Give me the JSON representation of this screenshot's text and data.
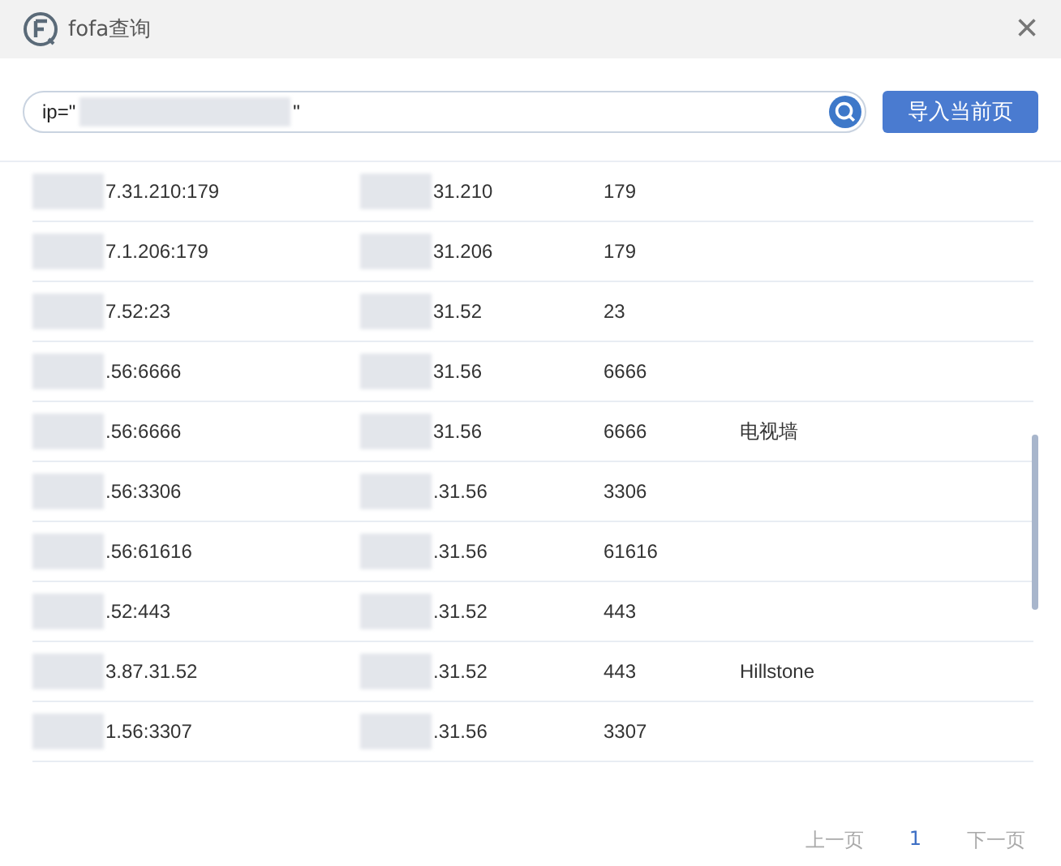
{
  "window": {
    "title": "fofa查询",
    "close": "×"
  },
  "search": {
    "prefix": "ip=\"",
    "suffix": "\"",
    "redacted": true
  },
  "import_button": "导入当前页",
  "rows": [
    {
      "host": "7.31.210:179",
      "ip": "31.210",
      "port": "179",
      "column_4": ""
    },
    {
      "host": "7.1.206:179",
      "ip": "31.206",
      "port": "179",
      "column_4": ""
    },
    {
      "host": "7.52:23",
      "ip": "31.52",
      "port": "23",
      "column_4": ""
    },
    {
      "host": ".56:6666",
      "ip": "31.56",
      "port": "6666",
      "column_4": ""
    },
    {
      "host": ".56:6666",
      "ip": "31.56",
      "port": "6666",
      "column_4": "电视墙"
    },
    {
      "host": ".56:3306",
      "ip": ".31.56",
      "port": "3306",
      "column_4": ""
    },
    {
      "host": ".56:61616",
      "ip": ".31.56",
      "port": "61616",
      "column_4": ""
    },
    {
      "host": ".52:443",
      "ip": ".31.52",
      "port": "443",
      "column_4": ""
    },
    {
      "host": "3.87.31.52",
      "ip": ".31.52",
      "port": "443",
      "column_4": "Hillstone"
    },
    {
      "host": "1.56:3307",
      "ip": ".31.56",
      "port": "3307",
      "column_4": ""
    }
  ],
  "pagination": {
    "prev": {
      "label": "上一页",
      "disabled": true
    },
    "page": "1",
    "next": {
      "label": "下一页",
      "disabled": true
    }
  }
}
